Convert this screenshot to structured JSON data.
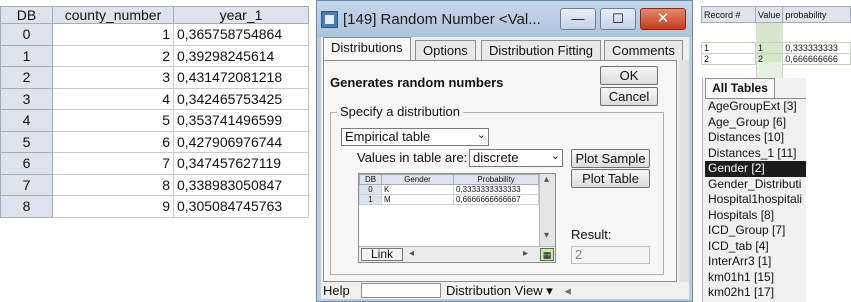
{
  "grid": {
    "headers": [
      "DB",
      "county_number",
      "year_1"
    ],
    "rows": [
      [
        "0",
        "1",
        "0,365758754864"
      ],
      [
        "1",
        "2",
        "0,39298245614"
      ],
      [
        "2",
        "3",
        "0,431472081218"
      ],
      [
        "3",
        "4",
        "0,342465753425"
      ],
      [
        "4",
        "5",
        "0,353741496599"
      ],
      [
        "5",
        "6",
        "0,427906976744"
      ],
      [
        "6",
        "7",
        "0,347457627119"
      ],
      [
        "7",
        "8",
        "0,338983050847"
      ],
      [
        "8",
        "9",
        "0,305084745763"
      ]
    ]
  },
  "dialog": {
    "title": "[149]  Random Number  <Val...",
    "min_symbol": "—",
    "max_symbol": "☐",
    "close_symbol": "✕",
    "tabs": [
      "Distributions",
      "Options",
      "Distribution Fitting",
      "Comments"
    ],
    "active_tab": "Distributions",
    "generates_label": "Generates random numbers",
    "ok_label": "OK",
    "cancel_label": "Cancel",
    "legend": "Specify a distribution",
    "distribution": "Empirical table",
    "values_label": "Values in table are:",
    "values_type": "discrete",
    "plot_sample": "Plot Sample",
    "plot_table": "Plot Table",
    "mini_table": {
      "headers": [
        "DB",
        "Gender",
        "Probability"
      ],
      "rows": [
        [
          "0",
          "K",
          "0,3333333333333"
        ],
        [
          "1",
          "M",
          "0,6666666666667"
        ]
      ]
    },
    "link_label": "Link",
    "result_label": "Result:",
    "result_value": "2",
    "help_label": "Help",
    "dist_view_label": "Distribution View"
  },
  "records": {
    "headers": [
      "Record #",
      "Value",
      "probability"
    ],
    "rows": [
      [
        "1",
        "1",
        "0,333333333"
      ],
      [
        "2",
        "2",
        "0,666666666"
      ]
    ]
  },
  "tables": {
    "tab_label": "All Tables",
    "items": [
      "AgeGroupExt [3]",
      "Age_Group [6]",
      "Distances [10]",
      "Distances_1 [11]",
      "Gender [2]",
      "Gender_Distributi",
      "Hospital1hospitali",
      "Hospitals [8]",
      "ICD_Group [7]",
      "ICD_tab [4]",
      "InterArr3 [1]",
      "km01h1 [15]",
      "km02h1 [17]"
    ],
    "selected": "Gender [2]"
  },
  "colors": {
    "header_bg": "#dde4ee",
    "selection_bg": "#1c1c1c",
    "close_button": "#c33c1f",
    "record_green": "#d5e8cc"
  }
}
